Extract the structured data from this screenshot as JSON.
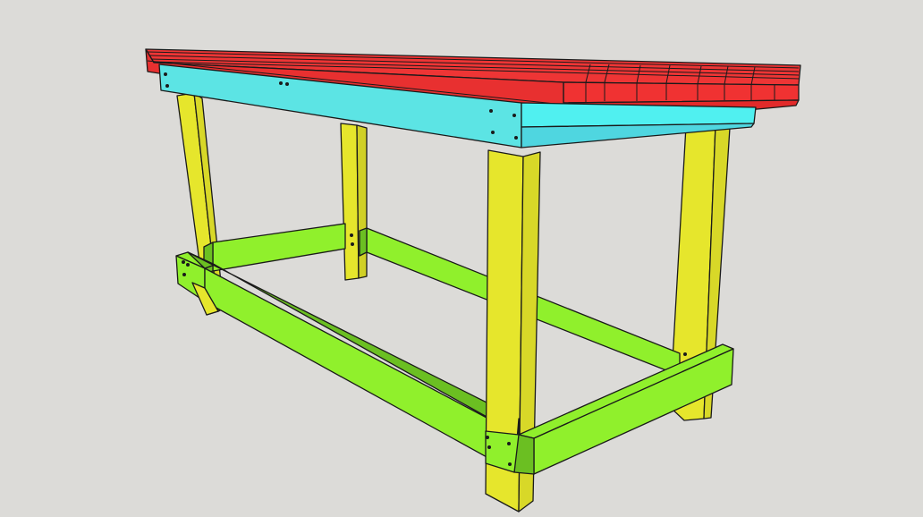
{
  "scene": {
    "subject": "workbench",
    "background_color": "#dcdbd8",
    "edge_color": "#1a1a1a",
    "parts": [
      {
        "name": "tabletop",
        "color": "#f03232",
        "top_color": "#ee3535",
        "side_color": "#e22a2a"
      },
      {
        "name": "apron",
        "color": "#5ce4e4",
        "shade_color": "#4fd6e0"
      },
      {
        "name": "legs",
        "color": "#e6e62c",
        "shade_color": "#d8d828"
      },
      {
        "name": "lower-stretchers",
        "color": "#90f02c",
        "shade_color": "#6bbf22"
      }
    ]
  }
}
